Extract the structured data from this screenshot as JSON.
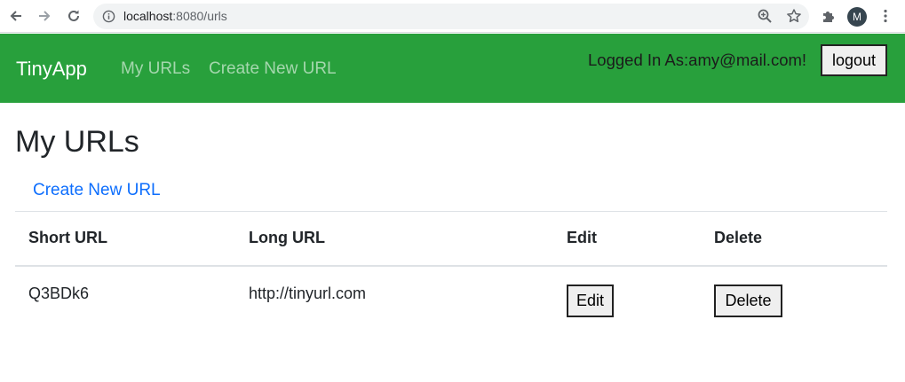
{
  "browser": {
    "url_host": "localhost",
    "url_path": ":8080/urls",
    "profile_initial": "M"
  },
  "navbar": {
    "brand": "TinyApp",
    "links": [
      "My URLs",
      "Create New URL"
    ],
    "logged_in_text": "Logged In As:amy@mail.com!",
    "logout_label": "logout",
    "background": "#28a03c"
  },
  "main": {
    "title": "My URLs",
    "create_link": "Create New URL",
    "table": {
      "headers": [
        "Short URL",
        "Long URL",
        "Edit",
        "Delete"
      ],
      "rows": [
        {
          "short_url": "Q3BDk6",
          "long_url": "http://tinyurl.com",
          "edit_label": "Edit",
          "delete_label": "Delete"
        }
      ]
    }
  },
  "icons": {
    "back": "arrow-left-icon",
    "forward": "arrow-right-icon",
    "reload": "reload-icon",
    "info": "info-icon",
    "zoom": "zoom-icon",
    "bookmark": "star-icon",
    "extensions": "puzzle-icon",
    "menu": "kebab-menu-icon"
  }
}
